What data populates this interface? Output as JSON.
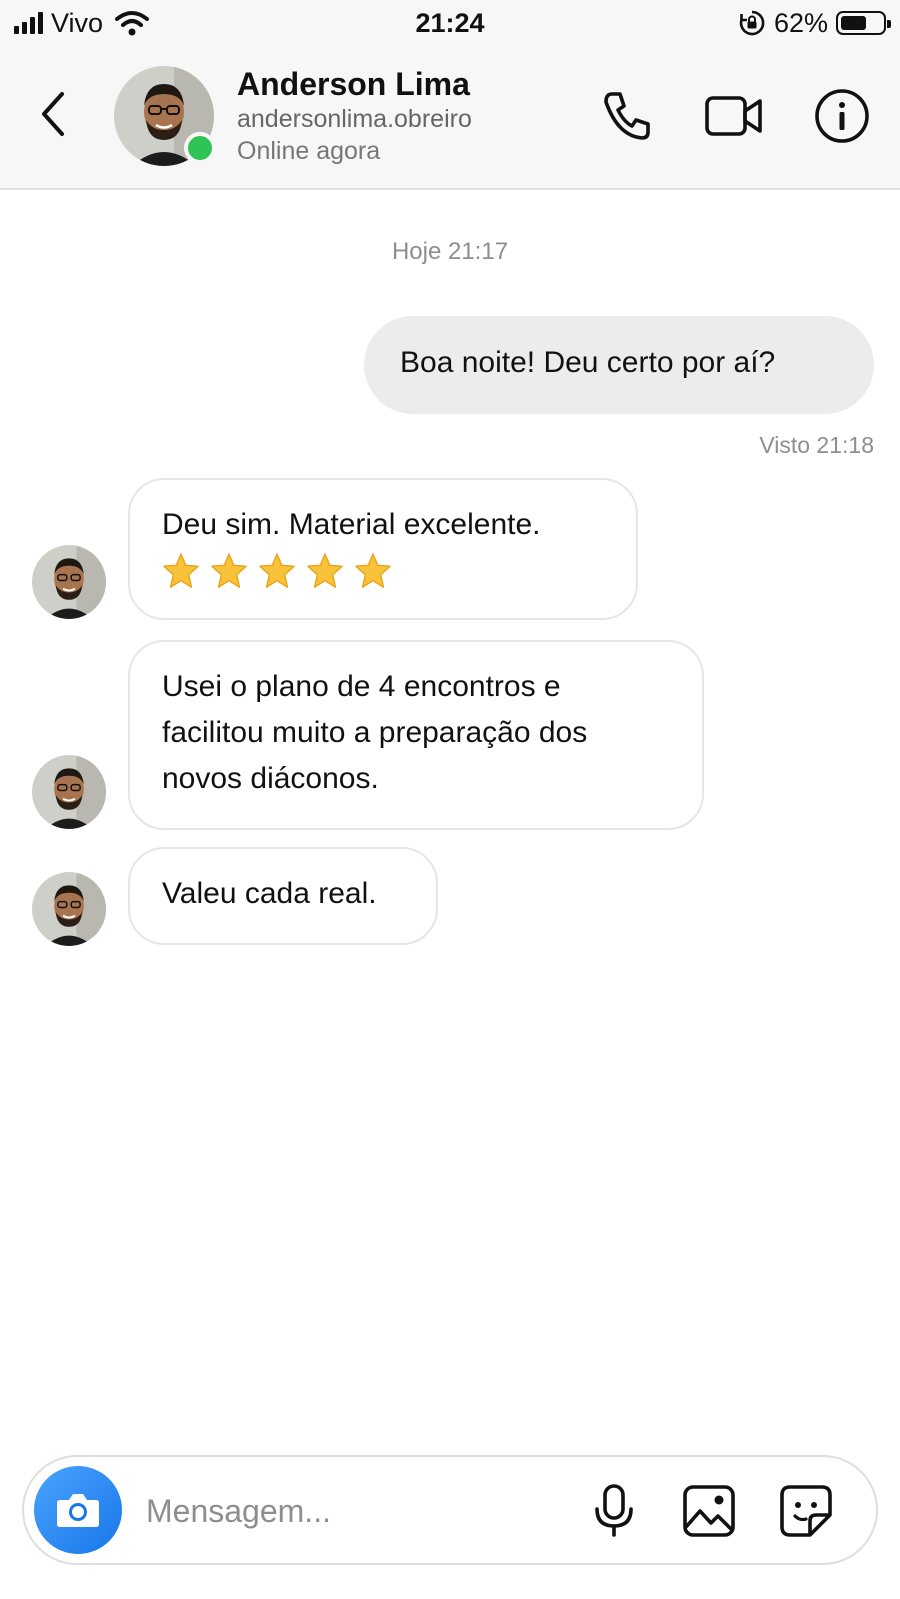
{
  "status_bar": {
    "carrier": "Vivo",
    "time": "21:24",
    "battery_percent_label": "62%",
    "battery_level": 0.62
  },
  "header": {
    "back_icon": "chevron-left-icon",
    "contact_name": "Anderson Lima",
    "contact_username": "andersonlima.obreiro",
    "contact_status": "Online agora",
    "online_color": "#2fc356",
    "actions": [
      "phone-icon",
      "video-camera-icon",
      "info-icon"
    ]
  },
  "chat": {
    "date_label": "Hoje 21:17",
    "outgoing": {
      "text": "Boa noite! Deu certo por aí?",
      "seen_label": "Visto 21:18"
    },
    "incoming": [
      {
        "text": "Deu sim. Material excelente.",
        "rating_stars": 5
      },
      {
        "text": "Usei o plano de 4 encontros e facilitou muito a preparação dos novos diáconos."
      },
      {
        "text": "Valeu cada real."
      }
    ]
  },
  "composer": {
    "placeholder": "Mensagem...",
    "accent_color": "#1877e8",
    "icons": [
      "camera-icon",
      "microphone-icon",
      "image-icon",
      "sticker-icon"
    ]
  }
}
